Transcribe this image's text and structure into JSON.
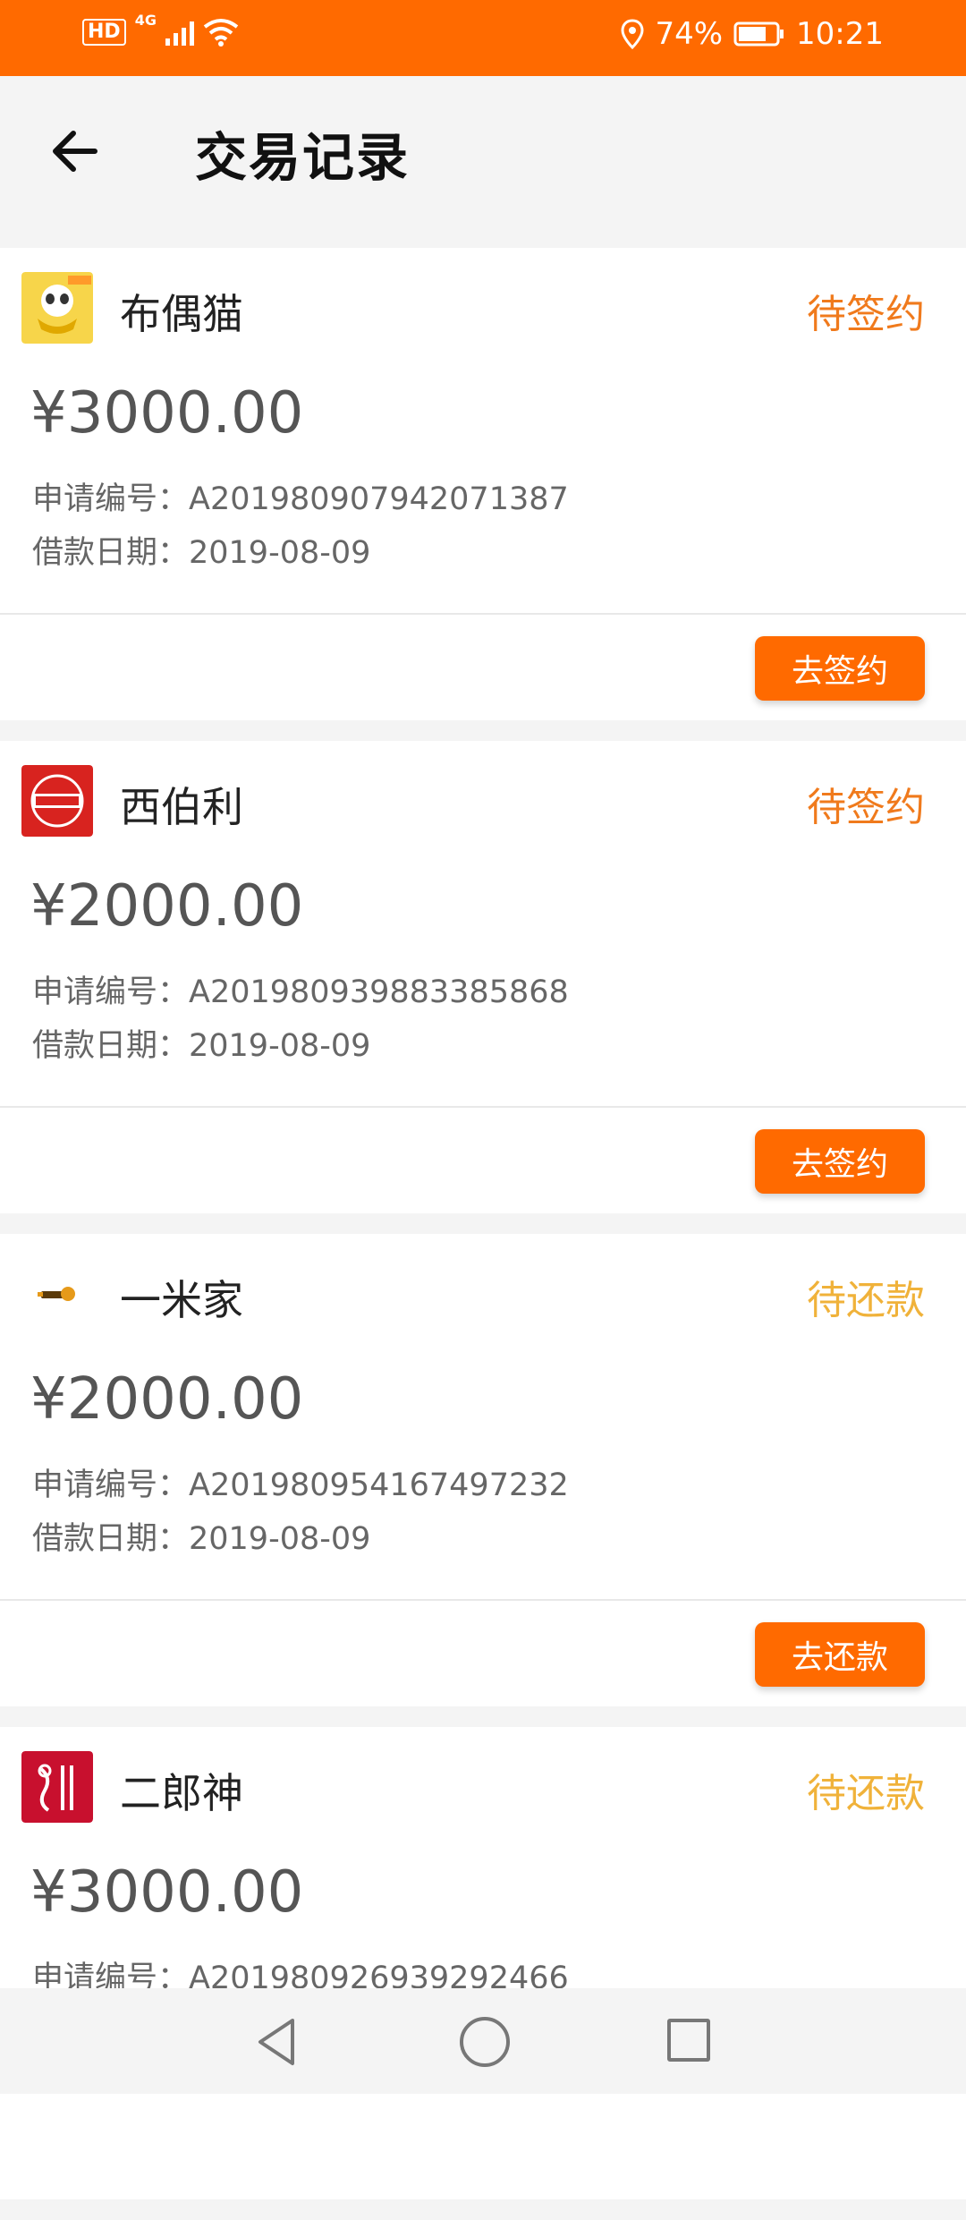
{
  "status_bar": {
    "hd": "HD",
    "network": "4G",
    "battery": "74%",
    "time": "10:21"
  },
  "header": {
    "title": "交易记录"
  },
  "records": [
    {
      "merchant": "布偶猫",
      "status": "待签约",
      "status_color": "#f07a1c",
      "amount": "¥3000.00",
      "app_no": "申请编号：A201980907942071387",
      "loan_date": "借款日期：2019-08-09",
      "action": "去签约",
      "logo_icon": "cat-logo-icon"
    },
    {
      "merchant": "西伯利",
      "status": "待签约",
      "status_color": "#f07a1c",
      "amount": "¥2000.00",
      "app_no": "申请编号：A201980939883385868",
      "loan_date": "借款日期：2019-08-09",
      "action": "去签约",
      "logo_icon": "xibo-logo-icon"
    },
    {
      "merchant": "一米家",
      "status": "待还款",
      "status_color": "#f0b23a",
      "amount": "¥2000.00",
      "app_no": "申请编号：A201980954167497232",
      "loan_date": "借款日期：2019-08-09",
      "action": "去还款",
      "logo_icon": "yimi-logo-icon"
    },
    {
      "merchant": "二郎神",
      "status": "待还款",
      "status_color": "#f0b23a",
      "amount": "¥3000.00",
      "app_no": "申请编号：A201980926939292466",
      "loan_date": "",
      "action": "",
      "logo_icon": "erlang-logo-icon"
    }
  ],
  "colors": {
    "accent": "#ff6a00"
  }
}
